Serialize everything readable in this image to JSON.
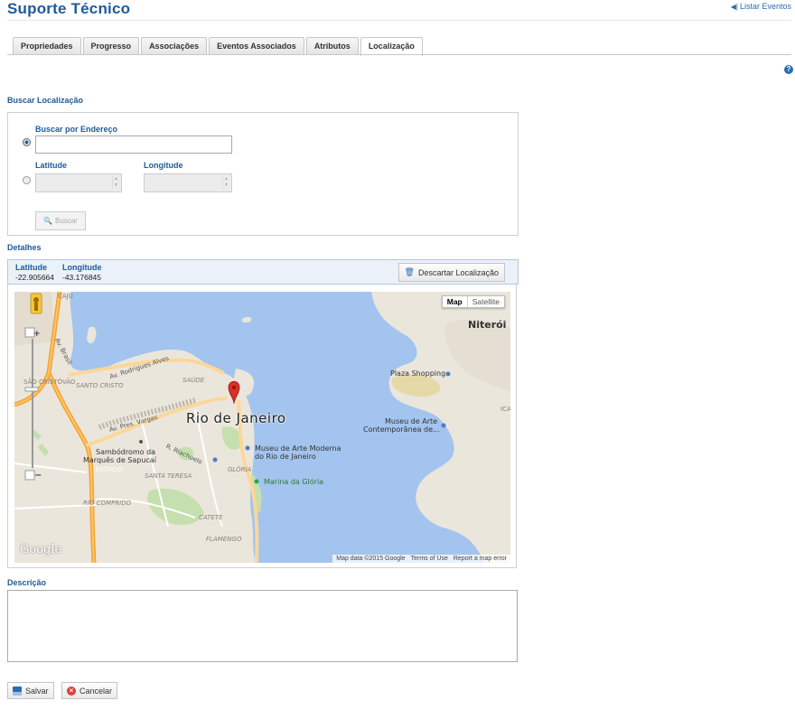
{
  "header": {
    "title": "Suporte Técnico",
    "list_link": "Listar Eventos"
  },
  "tabs": [
    {
      "label": "Propriedades"
    },
    {
      "label": "Progresso"
    },
    {
      "label": "Associações"
    },
    {
      "label": "Eventos Associados"
    },
    {
      "label": "Atributos"
    },
    {
      "label": "Localização",
      "active": true
    }
  ],
  "help_icon": "?",
  "search": {
    "section_label": "Buscar Localização",
    "by_address_label": "Buscar por Endereço",
    "address_value": "",
    "latitude_label": "Latitude",
    "longitude_label": "Longitude",
    "latitude_value": "",
    "longitude_value": "",
    "search_button": "Buscar",
    "selected_mode": "address"
  },
  "details": {
    "section_label": "Detalhes",
    "latitude_header": "Latitude",
    "longitude_header": "Longitude",
    "latitude_value": "-22.905664",
    "longitude_value": "-43.176845",
    "discard_button": "Descartar Localização"
  },
  "map": {
    "map_button": "Map",
    "satellite_button": "Satellite",
    "city_label": "Rio de Janeiro",
    "niteroi": "Niterói",
    "caju": "CAJU",
    "sao_cristovao": "SÃO CRISTÓVÃO",
    "santo_cristo": "SANTO CRISTO",
    "saude": "SAÚDE",
    "av_rodrigues": "Av. Rodrigues Alves",
    "av_brasil": "Av. Brasil",
    "av_pres_vargas": "Av. Pres. Vargas",
    "r_riachuelo": "R. Riachuelo",
    "sambodromo_1": "Sambódromo da",
    "sambodromo_2": "Marquês de Sapucaí",
    "estacio": "ESTÁCIO",
    "santa_teresa": "SANTA TERESA",
    "gloria": "GLÓRIA",
    "rio_comprido": "RIO COMPRIDO",
    "catete": "CATETE",
    "flamengo": "FLAMENGO",
    "museu_mam_1": "Museu de Arte Moderna",
    "museu_mam_2": "do Rio de Janeiro",
    "marina": "Marina da Glória",
    "plaza": "Plaza Shopping",
    "mac_1": "Museu de Arte",
    "mac_2": "Contemporânea de...",
    "ica": "ICA",
    "logo": "Google",
    "attrib_data": "Map data ©2015 Google",
    "attrib_terms": "Terms of Use",
    "attrib_report": "Report a map error",
    "zoom_in": "+",
    "zoom_out": "−"
  },
  "description": {
    "label": "Descrição",
    "value": ""
  },
  "actions": {
    "save": "Salvar",
    "cancel": "Cancelar"
  },
  "colors": {
    "brand": "#1f5a99",
    "water": "#a3c4ee",
    "land": "#ebe6dc",
    "marker": "#d93025"
  }
}
